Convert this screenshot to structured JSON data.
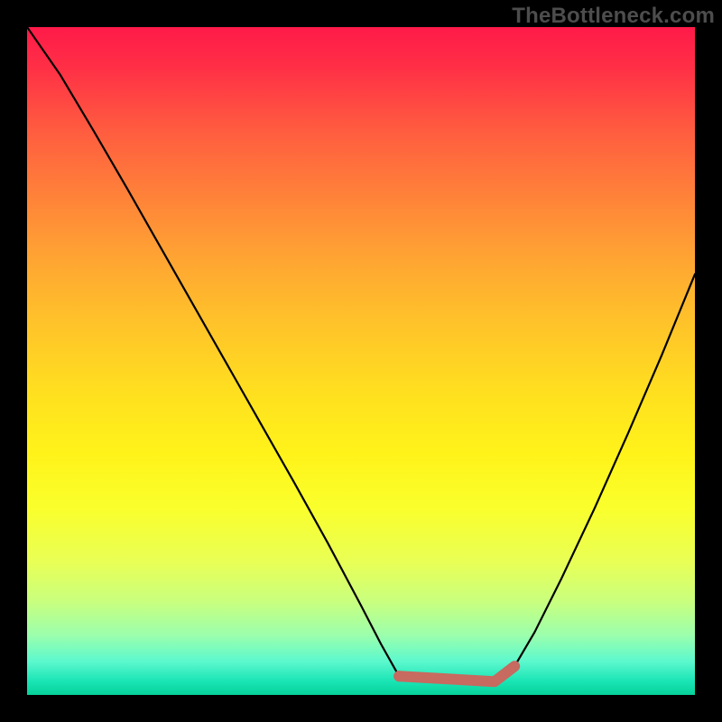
{
  "watermark": "TheBottleneck.com",
  "chart_data": {
    "type": "line",
    "title": "",
    "xlabel": "",
    "ylabel": "",
    "xlim": [
      0,
      1
    ],
    "ylim": [
      0,
      1
    ],
    "grid": false,
    "series": [
      {
        "name": "bottleneck-curve",
        "color": "#000000",
        "x": [
          0.0,
          0.05,
          0.1,
          0.15,
          0.2,
          0.25,
          0.3,
          0.35,
          0.4,
          0.45,
          0.5,
          0.53,
          0.557,
          0.6,
          0.65,
          0.7,
          0.73,
          0.76,
          0.8,
          0.85,
          0.9,
          0.95,
          1.0
        ],
        "y": [
          1.0,
          0.928,
          0.844,
          0.758,
          0.67,
          0.582,
          0.494,
          0.406,
          0.318,
          0.228,
          0.134,
          0.076,
          0.028,
          0.02,
          0.02,
          0.02,
          0.043,
          0.094,
          0.174,
          0.28,
          0.392,
          0.508,
          0.63
        ]
      },
      {
        "name": "optimal-range",
        "color": "#c76a60",
        "x": [
          0.557,
          0.7,
          0.73
        ],
        "y": [
          0.028,
          0.02,
          0.043
        ]
      }
    ],
    "annotations": [
      {
        "name": "optimal-point",
        "x": 0.557,
        "y": 0.028,
        "text": ""
      }
    ],
    "background": {
      "gradient_stops": [
        {
          "pos": 0.0,
          "color": "#ff1a49"
        },
        {
          "pos": 0.15,
          "color": "#ff5a40"
        },
        {
          "pos": 0.34,
          "color": "#ffa233"
        },
        {
          "pos": 0.55,
          "color": "#ffe01f"
        },
        {
          "pos": 0.72,
          "color": "#faff2c"
        },
        {
          "pos": 0.86,
          "color": "#c9ff7e"
        },
        {
          "pos": 0.95,
          "color": "#5cf8ce"
        },
        {
          "pos": 1.0,
          "color": "#06d29a"
        }
      ]
    }
  }
}
